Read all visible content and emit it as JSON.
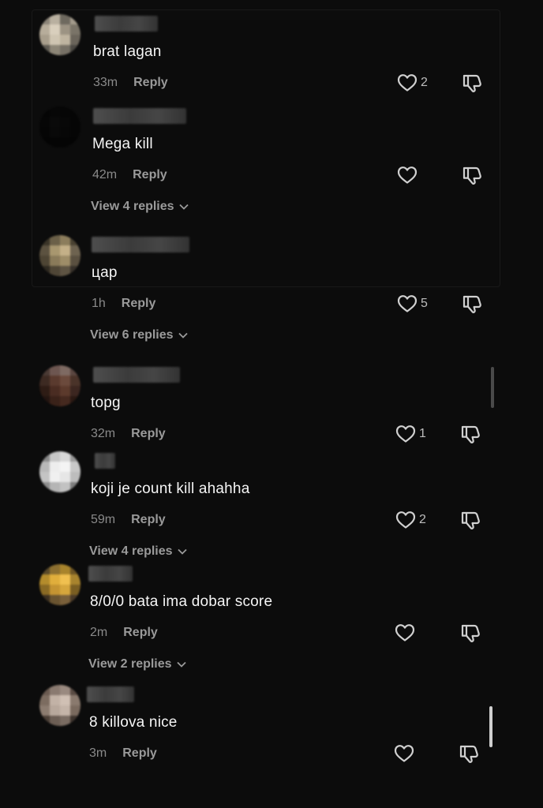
{
  "comments": [
    {
      "text": "brat lagan",
      "time": "33m",
      "reply": "Reply",
      "likes": "2",
      "view_replies": ""
    },
    {
      "text": "Mega kill",
      "time": "42m",
      "reply": "Reply",
      "likes": "",
      "view_replies": "View 4 replies"
    },
    {
      "text": "цар",
      "time": "1h",
      "reply": "Reply",
      "likes": "5",
      "view_replies": "View 6 replies"
    },
    {
      "text": "topg",
      "time": "32m",
      "reply": "Reply",
      "likes": "1",
      "view_replies": ""
    },
    {
      "text": "koji je count kill ahahha",
      "time": "59m",
      "reply": "Reply",
      "likes": "2",
      "view_replies": "View 4 replies"
    },
    {
      "text": "8/0/0 bata ima dobar score",
      "time": "2m",
      "reply": "Reply",
      "likes": "",
      "view_replies": "View 2 replies"
    },
    {
      "text": "8 killova nice",
      "time": "3m",
      "reply": "Reply",
      "likes": "",
      "view_replies": ""
    }
  ],
  "icons": {
    "like": "heart-icon",
    "dislike": "thumbs-down-icon",
    "expand": "chevron-down-icon"
  },
  "colors": {
    "background": "#0c0c0c",
    "text": "#f5f5f5",
    "muted": "#8a8a8a",
    "icon": "#c8c8c8"
  }
}
